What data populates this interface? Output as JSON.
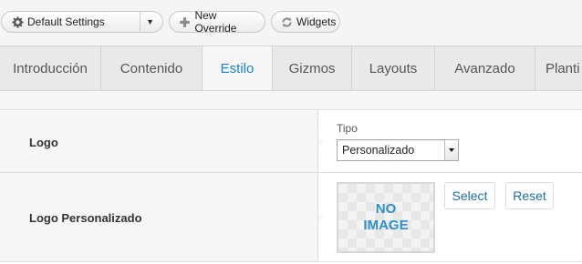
{
  "toolbar": {
    "settings_label": "Default Settings",
    "settings_icon": "gear-icon",
    "override_label": "New Override",
    "override_icon": "plus-icon",
    "widgets_label": "Widgets",
    "widgets_icon": "widgets-icon"
  },
  "tabs": [
    {
      "label": "Introducción",
      "active": false
    },
    {
      "label": "Contenido",
      "active": false
    },
    {
      "label": "Estilo",
      "active": true
    },
    {
      "label": "Gizmos",
      "active": false
    },
    {
      "label": "Layouts",
      "active": false
    },
    {
      "label": "Avanzado",
      "active": false
    },
    {
      "label": "Planti",
      "active": false
    }
  ],
  "colors": {
    "accent": "#1a84c6",
    "label_bg": "#f6f6f6",
    "tab_bg": "#e9e9e9"
  },
  "settings": {
    "logo": {
      "label": "Logo",
      "type_label": "Tipo",
      "type_value": "Personalizado"
    },
    "custom_logo": {
      "label": "Logo Personalizado",
      "placeholder_line1": "NO",
      "placeholder_line2": "IMAGE",
      "select_label": "Select",
      "reset_label": "Reset"
    }
  }
}
